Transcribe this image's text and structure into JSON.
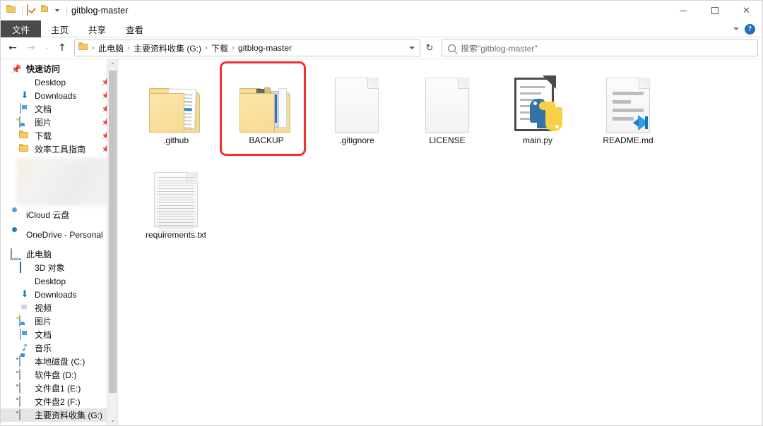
{
  "window": {
    "title": "gitblog-master",
    "controls": {
      "minimize": "minimize",
      "maximize": "maximize",
      "close": "close"
    }
  },
  "quick_access_toolbar": {
    "folder_icon": "folder-icon",
    "properties_icon": "properties-icon",
    "new_folder_icon": "new-folder-icon",
    "customize_caret": "chevron-down-icon"
  },
  "ribbon": {
    "tabs": [
      {
        "label": "文件",
        "active": true
      },
      {
        "label": "主页",
        "active": false
      },
      {
        "label": "共享",
        "active": false
      },
      {
        "label": "查看",
        "active": false
      }
    ],
    "expand_icon": "chevron-down-icon",
    "help_label": "?"
  },
  "addressbar": {
    "back_icon": "arrow-left-icon",
    "forward_icon": "arrow-right-icon",
    "recent_icon": "chevron-down-icon",
    "up_icon": "arrow-up-icon",
    "path_icon": "folder-icon",
    "breadcrumbs": [
      "此电脑",
      "主要资料收集 (G:)",
      "下载",
      "gitblog-master"
    ],
    "separator": "›",
    "dropdown_icon": "chevron-down-icon",
    "refresh_icon": "refresh-icon",
    "search": {
      "placeholder": "搜索\"gitblog-master\"",
      "value": "",
      "icon": "search-icon"
    }
  },
  "sidebar": {
    "groups": [
      {
        "header": {
          "label": "快速访问",
          "icon": "pin-icon"
        },
        "items": [
          {
            "label": "Desktop",
            "icon": "desktop-icon",
            "pinned": true
          },
          {
            "label": "Downloads",
            "icon": "download-icon",
            "pinned": true
          },
          {
            "label": "文档",
            "icon": "documents-icon",
            "pinned": true
          },
          {
            "label": "图片",
            "icon": "pictures-icon",
            "pinned": true
          },
          {
            "label": "下载",
            "icon": "folder-icon",
            "pinned": true
          },
          {
            "label": "效率工具指南",
            "icon": "folder-icon",
            "pinned": true
          }
        ],
        "blurred_region": true
      },
      {
        "header": {
          "label": "iCloud 云盘",
          "icon": "icloud-icon"
        },
        "items": []
      },
      {
        "header": {
          "label": "OneDrive - Personal",
          "icon": "onedrive-icon"
        },
        "items": []
      },
      {
        "header": {
          "label": "此电脑",
          "icon": "this-pc-icon"
        },
        "items": [
          {
            "label": "3D 对象",
            "icon": "3d-objects-icon",
            "pinned": false
          },
          {
            "label": "Desktop",
            "icon": "desktop-icon",
            "pinned": false
          },
          {
            "label": "Downloads",
            "icon": "download-icon",
            "pinned": false
          },
          {
            "label": "视频",
            "icon": "videos-icon",
            "pinned": false
          },
          {
            "label": "图片",
            "icon": "pictures-icon",
            "pinned": false
          },
          {
            "label": "文档",
            "icon": "documents-icon",
            "pinned": false
          },
          {
            "label": "音乐",
            "icon": "music-icon",
            "pinned": false
          },
          {
            "label": "本地磁盘 (C:)",
            "icon": "system-drive-icon",
            "pinned": false
          },
          {
            "label": "软件盘 (D:)",
            "icon": "drive-icon",
            "pinned": false
          },
          {
            "label": "文件盘1 (E:)",
            "icon": "drive-icon",
            "pinned": false
          },
          {
            "label": "文件盘2 (F:)",
            "icon": "drive-icon",
            "pinned": false
          },
          {
            "label": "主要资料收集 (G:)",
            "icon": "drive-icon",
            "pinned": false,
            "selected": true
          }
        ]
      }
    ],
    "scrollbar": {
      "up_arrow": "chevron-up-icon",
      "down_arrow": "chevron-down-icon"
    }
  },
  "content": {
    "view": "large-icons",
    "items": [
      {
        "name": ".github",
        "type": "folder",
        "icon": "folder-with-documents-icon",
        "highlighted": false
      },
      {
        "name": "BACKUP",
        "type": "folder",
        "icon": "folder-with-books-icon",
        "highlighted": true
      },
      {
        "name": ".gitignore",
        "type": "file",
        "icon": "blank-file-icon",
        "highlighted": false
      },
      {
        "name": "LICENSE",
        "type": "file",
        "icon": "blank-file-icon",
        "highlighted": false
      },
      {
        "name": "main.py",
        "type": "file",
        "icon": "python-file-icon",
        "highlighted": false
      },
      {
        "name": "README.md",
        "type": "file",
        "icon": "markdown-vscode-file-icon",
        "highlighted": false
      },
      {
        "name": "requirements.txt",
        "type": "file",
        "icon": "text-file-icon",
        "highlighted": false
      }
    ]
  },
  "annotation": {
    "highlight_color": "#f23030",
    "target": "BACKUP"
  }
}
